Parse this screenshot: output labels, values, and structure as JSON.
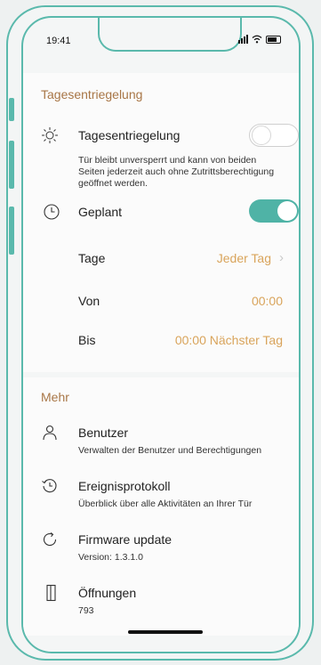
{
  "status_bar": {
    "time": "19:41"
  },
  "day_unlock": {
    "section_title": "Tagesentriegelung",
    "toggle_label": "Tagesentriegelung",
    "toggle_state": "off",
    "description": [
      "Tür bleibt unversperrt und kann von beiden",
      "Seiten jederzeit auch ohne Zutrittsberechtigung",
      "geöffnet werden."
    ],
    "scheduled_label": "Geplant",
    "scheduled_state": "on",
    "rows": [
      {
        "label": "Tage",
        "value": "Jeder Tag",
        "chevron": "›"
      },
      {
        "label": "Von",
        "value": "00:00"
      },
      {
        "label": "Bis",
        "value": "00:00 Nächster Tag"
      }
    ]
  },
  "more": {
    "section_title": "Mehr",
    "items": [
      {
        "title": "Benutzer",
        "subtitle": "Verwalten der Benutzer und Berechtigungen",
        "icon": "user-icon"
      },
      {
        "title": "Ereignisprotokoll",
        "subtitle": "Überblick über alle Aktivitäten an Ihrer Tür",
        "icon": "history-icon"
      },
      {
        "title": "Firmware update",
        "subtitle": "Version: 1.3.1.0",
        "icon": "refresh-icon"
      },
      {
        "title": "Öffnungen",
        "subtitle": "793",
        "icon": "door-icon"
      }
    ]
  },
  "colors": {
    "accent": "#4fb3a6",
    "section_title": "#a87646",
    "value": "#d9a45b"
  }
}
